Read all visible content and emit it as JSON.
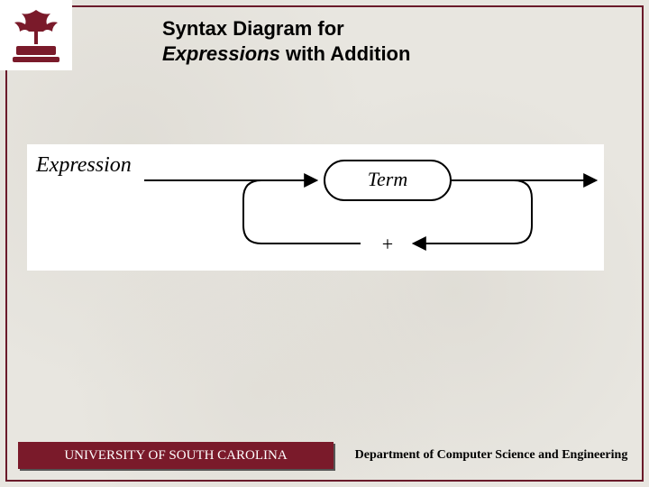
{
  "title": {
    "line1": "Syntax Diagram for",
    "line2_italic": "Expressions",
    "line2_rest": " with Addition"
  },
  "diagram": {
    "entry_label": "Expression",
    "node_label": "Term",
    "loop_label": "+"
  },
  "footer": {
    "left": "UNIVERSITY OF SOUTH CAROLINA",
    "right": "Department of Computer Science and Engineering"
  },
  "theme": {
    "accent": "#7a1a2a"
  }
}
